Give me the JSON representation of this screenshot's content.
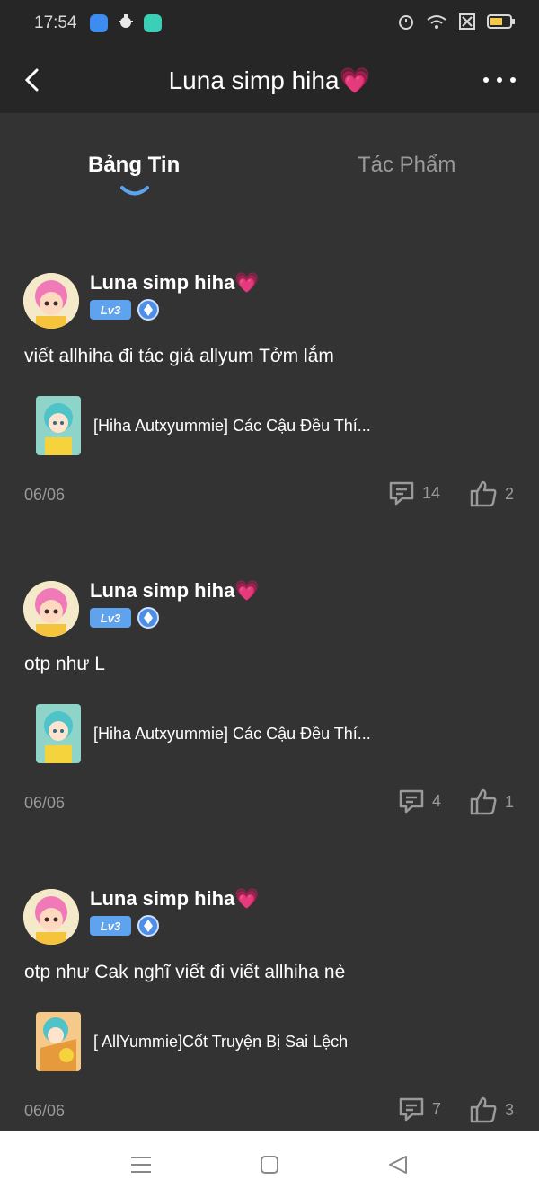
{
  "status_bar": {
    "time": "17:54",
    "icons": [
      "app-blue-icon",
      "bug-icon",
      "chat-app-icon",
      "alarm-icon",
      "wifi-icon",
      "sim-off-icon",
      "battery-icon"
    ]
  },
  "header": {
    "title": "Luna simp hiha💗",
    "back_icon": "chevron-left-icon",
    "more_icon": "more-dots-icon"
  },
  "tabs": [
    {
      "label": "Bảng Tin",
      "active": true
    },
    {
      "label": "Tác Phẩm",
      "active": false
    }
  ],
  "posts": [
    {
      "author": "Luna simp hiha💗",
      "level": "Lv3",
      "text": "viết allhiha đi tác giả allyum Tởm lắm",
      "work_title": "[Hiha Autxyummie] Các Cậu Đều Thí...",
      "date": "06/06",
      "comments": "14",
      "likes": "2"
    },
    {
      "author": "Luna simp hiha💗",
      "level": "Lv3",
      "text": "otp như L",
      "work_title": "[Hiha Autxyummie] Các Cậu Đều Thí...",
      "date": "06/06",
      "comments": "4",
      "likes": "1"
    },
    {
      "author": "Luna simp hiha💗",
      "level": "Lv3",
      "text": "otp như Cak nghĩ viết đi viết allhiha nè",
      "work_title": "[ AllYummie]Cốt Truyện Bị Sai Lệch",
      "date": "06/06",
      "comments": "7",
      "likes": "3"
    }
  ],
  "colors": {
    "background": "#333333",
    "header": "#262626",
    "accent": "#5fa3ef",
    "muted_text": "#9a9a9a"
  }
}
